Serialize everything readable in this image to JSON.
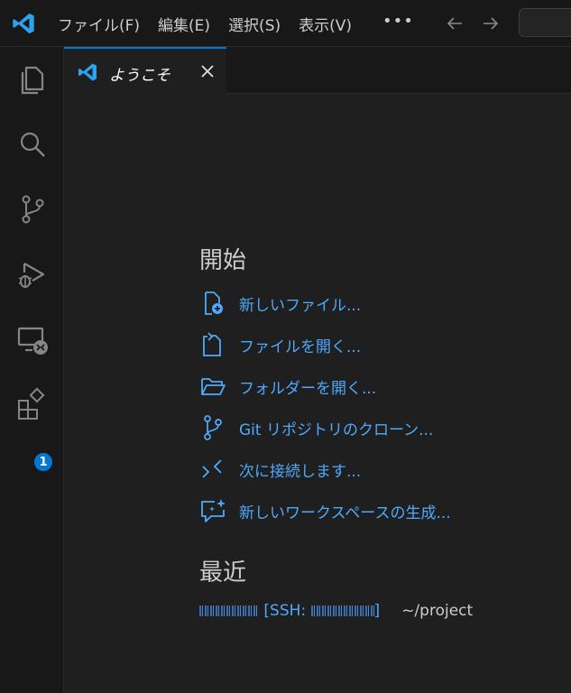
{
  "titlebar": {
    "menu": [
      "ファイル(F)",
      "編集(E)",
      "選択(S)",
      "表示(V)"
    ],
    "more_label": "•••",
    "icons": {
      "logo": "vscode-logo-icon",
      "back": "arrow-left-icon",
      "forward": "arrow-right-icon"
    }
  },
  "activitybar": {
    "items": [
      "explorer-icon",
      "search-icon",
      "source-control-icon",
      "run-debug-icon",
      "remote-explorer-icon",
      "extensions-icon"
    ],
    "extensions_badge": "1"
  },
  "tab": {
    "label": "ようこそ",
    "icons": {
      "tab": "vscode-logo-icon",
      "close": "close-icon"
    }
  },
  "welcome": {
    "start_title": "開始",
    "start_items": [
      {
        "label": "新しいファイル...",
        "icon": "new-file-icon"
      },
      {
        "label": "ファイルを開く...",
        "icon": "open-file-icon"
      },
      {
        "label": "フォルダーを開く...",
        "icon": "folder-icon"
      },
      {
        "label": "Git リポジトリのクローン...",
        "icon": "git-branch-icon"
      },
      {
        "label": "次に接続します...",
        "icon": "remote-connect-icon"
      },
      {
        "label": "新しいワークスペースの生成...",
        "icon": "sparkle-chat-icon"
      }
    ],
    "recent_title": "最近",
    "recent": {
      "host_visible": "[SSH:",
      "host_end": "]",
      "path": "~/project"
    }
  },
  "colors": {
    "accent": "#0078d4",
    "link": "#4daafc",
    "background": "#1f1f1f",
    "chrome": "#181818"
  }
}
